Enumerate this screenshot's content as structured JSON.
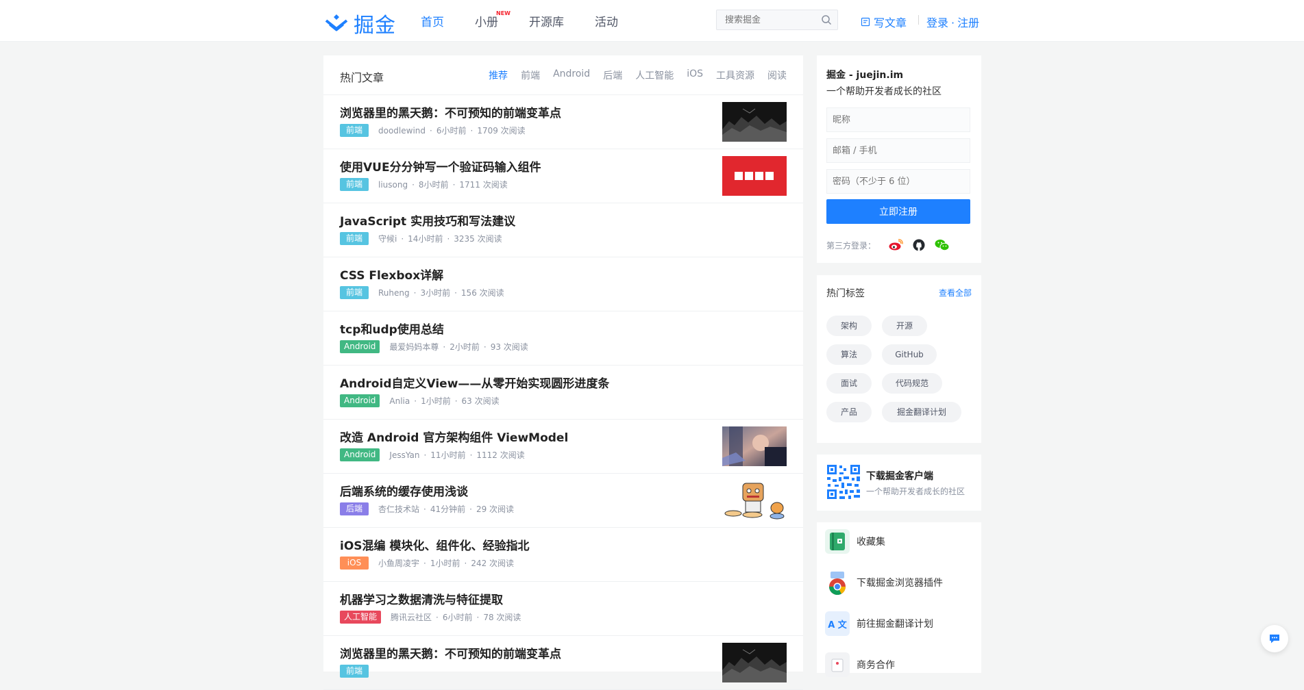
{
  "header": {
    "logo_text": "掘金",
    "nav": [
      {
        "label": "首页",
        "active": true
      },
      {
        "label": "小册",
        "badge": "NEW"
      },
      {
        "label": "开源库"
      },
      {
        "label": "活动"
      }
    ],
    "search_placeholder": "搜索掘金",
    "write_label": "写文章",
    "login_label": "登录",
    "dot": "·",
    "register_label": "注册"
  },
  "feed": {
    "title": "热门文章",
    "tabs": [
      "推荐",
      "前端",
      "Android",
      "后端",
      "人工智能",
      "iOS",
      "工具资源",
      "阅读"
    ],
    "active_tab": "推荐",
    "tag_colors": {
      "前端": "#56c4e1",
      "Android": "#41b883",
      "后端": "#8a7ee8",
      "iOS": "#ff8f57",
      "人工智能": "#e8485c"
    },
    "articles": [
      {
        "title": "浏览器里的黑天鹅：不可预知的前端变革点",
        "tag": "前端",
        "author": "doodlewind",
        "time": "6小时前",
        "reads": "1709 次阅读",
        "thumb": "dark"
      },
      {
        "title": "使用VUE分分钟写一个验证码输入组件",
        "tag": "前端",
        "author": "liusong",
        "time": "8小时前",
        "reads": "1711 次阅读",
        "thumb": "red"
      },
      {
        "title": "JavaScript 实用技巧和写法建议",
        "tag": "前端",
        "author": "守候i",
        "time": "14小时前",
        "reads": "3235 次阅读"
      },
      {
        "title": "CSS Flexbox详解",
        "tag": "前端",
        "author": "Ruheng",
        "time": "3小时前",
        "reads": "156 次阅读"
      },
      {
        "title": "tcp和udp使用总结",
        "tag": "Android",
        "author": "最爱妈妈本尊",
        "time": "2小时前",
        "reads": "93 次阅读"
      },
      {
        "title": "Android自定义View——从零开始实现圆形进度条",
        "tag": "Android",
        "author": "Anlia",
        "time": "1小时前",
        "reads": "63 次阅读"
      },
      {
        "title": "改造 Android 官方架构组件 ViewModel",
        "tag": "Android",
        "author": "JessYan",
        "time": "11小时前",
        "reads": "1112 次阅读",
        "thumb": "photo"
      },
      {
        "title": "后端系统的缓存使用浅谈",
        "tag": "后端",
        "author": "杏仁技术站",
        "time": "41分钟前",
        "reads": "29 次阅读",
        "thumb": "cartoon"
      },
      {
        "title": "iOS混编 模块化、组件化、经验指北",
        "tag": "iOS",
        "author": "小鱼周凌宇",
        "time": "1小时前",
        "reads": "242 次阅读"
      },
      {
        "title": "机器学习之数据清洗与特征提取",
        "tag": "人工智能",
        "author": "腾讯云社区",
        "time": "6小时前",
        "reads": "78 次阅读"
      },
      {
        "title": "浏览器里的黑天鹅：不可预知的前端变革点",
        "tag": "前端",
        "author": "",
        "time": "",
        "reads": "",
        "thumb": "dark"
      }
    ]
  },
  "register": {
    "title": "掘金 - juejin.im",
    "subtitle": "一个帮助开发者成长的社区",
    "nickname_placeholder": "昵称",
    "email_placeholder": "邮箱 / 手机",
    "password_placeholder": "密码（不少于 6 位）",
    "submit_label": "立即注册",
    "third_party_label": "第三方登录："
  },
  "hot_tags": {
    "title": "热门标签",
    "more_label": "查看全部",
    "tags": [
      "架构",
      "开源",
      "算法",
      "GitHub",
      "面试",
      "代码规范",
      "产品",
      "掘金翻译计划"
    ]
  },
  "app_download": {
    "title": "下载掘金客户端",
    "subtitle": "一个帮助开发者成长的社区"
  },
  "links": [
    {
      "label": "收藏集",
      "icon": "collection-icon"
    },
    {
      "label": "下载掘金浏览器插件",
      "icon": "chrome-icon"
    },
    {
      "label": "前往掘金翻译计划",
      "icon": "translate-icon"
    },
    {
      "label": "商务合作",
      "icon": "business-icon"
    }
  ]
}
